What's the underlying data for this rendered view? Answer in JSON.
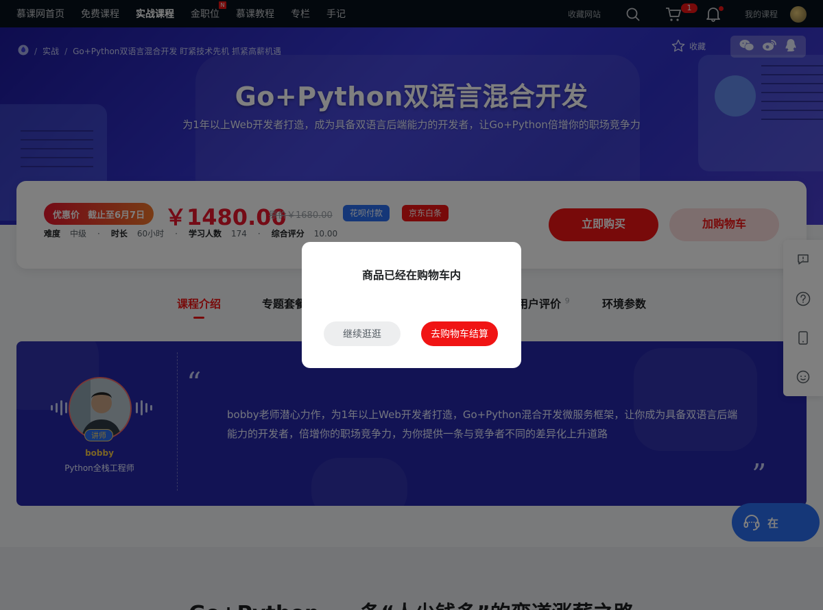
{
  "nav": {
    "items": [
      {
        "label": "慕课网首页"
      },
      {
        "label": "免费课程"
      },
      {
        "label": "实战课程"
      },
      {
        "label": "金职位"
      },
      {
        "label": "慕课教程"
      },
      {
        "label": "专栏"
      },
      {
        "label": "手记"
      }
    ],
    "new_badge": "N",
    "fav_site": "收藏网站",
    "cart_count": "1",
    "my_course": "我的课程"
  },
  "banner": {
    "breadcrumb_1": "实战",
    "breadcrumb_2": "Go+Python双语言混合开发 盯紧技术先机 抓紧高薪机遇",
    "title": "Go+Python双语言混合开发",
    "subtitle": "为1年以上Web开发者打造，成为具备双语言后端能力的开发者，让Go+Python倍增你的职场竞争力",
    "fav_label": "收藏"
  },
  "purchase": {
    "promo_label": "优惠价",
    "promo_deadline": "截止至6月7日",
    "price": "￥1480.00",
    "original_price": "原价￥1680.00",
    "pay_huabei": "花呗付款",
    "pay_jd": "京东白条",
    "meta": {
      "difficulty_k": "难度",
      "difficulty_v": "中级",
      "duration_k": "时长",
      "duration_v": "60小时",
      "learners_k": "学习人数",
      "learners_v": "174",
      "rating_k": "综合评分",
      "rating_v": "10.00"
    },
    "buy_now": "立即购买",
    "add_cart": "加购物车"
  },
  "tabs": {
    "intro": "课程介绍",
    "package": "专题套餐",
    "reviews": "用户评价",
    "reviews_count": "9",
    "env": "环境参数"
  },
  "teacher": {
    "badge": "讲师",
    "name": "bobby",
    "title": "Python全栈工程师",
    "quote_open": "“",
    "quote_close": "”",
    "description": "bobby老师潜心力作，为1年以上Web开发者打造，Go+Python混合开发微服务框架，让你成为具备双语言后端能力的开发者，倍增你的职场竞争力，为你提供一条与竞争者不同的差异化上升道路"
  },
  "bottom": {
    "title": "Go+Python，一条“人少钱多”的弯道涨薪之路"
  },
  "service": {
    "label": "在"
  },
  "modal": {
    "message": "商品已经在购物车内",
    "continue": "继续逛逛",
    "checkout": "去购物车结算"
  },
  "colors": {
    "accent": "#f01414",
    "nav_bg": "#07111b",
    "banner": "#2f31c8",
    "pay_blue": "#2b6ff0"
  }
}
